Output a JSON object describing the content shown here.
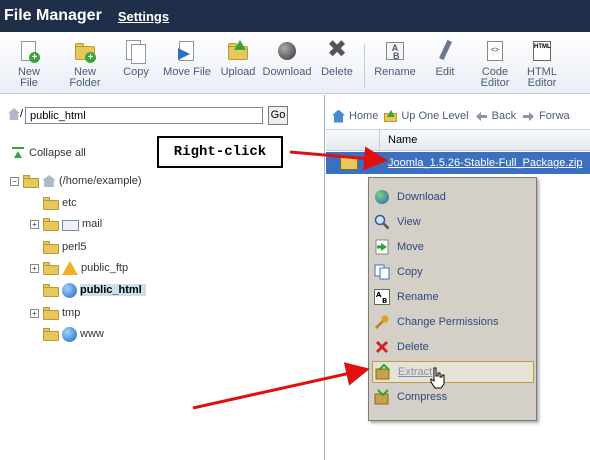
{
  "title_bar": {
    "app_title": "File Manager",
    "settings_link": "Settings"
  },
  "toolbar": {
    "buttons": [
      {
        "label": "New File",
        "icon": "new-file-icon"
      },
      {
        "label": "New\nFolder",
        "icon": "new-folder-icon"
      },
      {
        "label": "Copy",
        "icon": "copy-icon"
      },
      {
        "label": "Move File",
        "icon": "move-file-icon"
      },
      {
        "label": "Upload",
        "icon": "upload-icon"
      },
      {
        "label": "Download",
        "icon": "download-icon"
      },
      {
        "label": "Delete",
        "icon": "delete-icon"
      },
      {
        "label": "Rename",
        "icon": "rename-icon"
      },
      {
        "label": "Edit",
        "icon": "edit-icon"
      },
      {
        "label": "Code\nEditor",
        "icon": "code-editor-icon"
      },
      {
        "label": "HTML\nEditor",
        "icon": "html-editor-icon"
      }
    ]
  },
  "left_pane": {
    "path_prefix": "/",
    "path_value": "public_html",
    "go_label": "Go",
    "collapse_all": "Collapse all",
    "tree": {
      "root": "(/home/example)",
      "items": [
        "etc",
        "mail",
        "perl5",
        "public_ftp",
        "public_html",
        "tmp",
        "www"
      ]
    }
  },
  "right_pane": {
    "nav": [
      "Home",
      "Up One Level",
      "Back",
      "Forwa"
    ],
    "column_name": "Name",
    "file_name": "Joomla_1.5.26-Stable-Full_Package.zip"
  },
  "context_menu": {
    "items": [
      "Download",
      "View",
      "Move",
      "Copy",
      "Rename",
      "Change Permissions",
      "Delete",
      "Extract",
      "Compress"
    ],
    "hovered": "Extract"
  },
  "annotation": {
    "callout_text": "Right-click",
    "arrow_color": "#e01010"
  }
}
